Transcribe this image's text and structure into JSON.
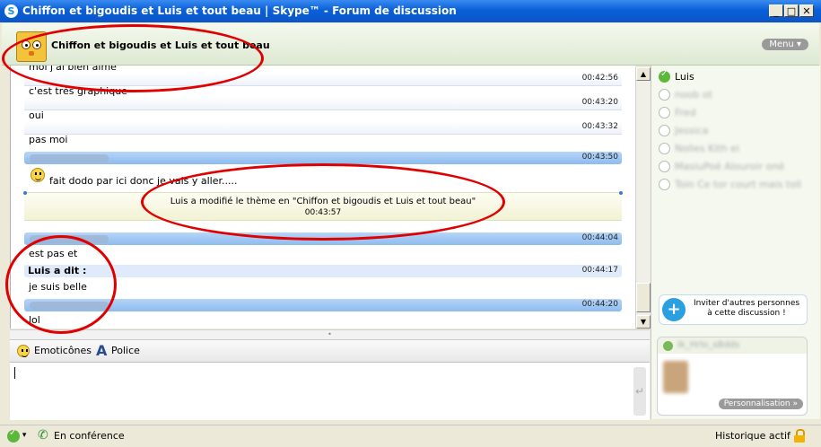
{
  "window": {
    "title": "Chiffon et bigoudis et Luis et tout beau | Skype™ - Forum de discussion",
    "min": "_",
    "max": "□",
    "close": "✕"
  },
  "header": {
    "title": "Chiffon et bigoudis et Luis et tout beau",
    "menu_label": "Menu"
  },
  "chat": {
    "rows": [
      {
        "kind": "msg",
        "text": "moi j'ai bien aimé"
      },
      {
        "kind": "sep",
        "time": "00:42:56"
      },
      {
        "kind": "msg",
        "text": "c'est très graphique"
      },
      {
        "kind": "sep",
        "time": "00:43:20"
      },
      {
        "kind": "msg",
        "text": "oui"
      },
      {
        "kind": "sep",
        "time": "00:43:32"
      },
      {
        "kind": "msg",
        "text": "pas moi"
      },
      {
        "kind": "bar",
        "time": "00:43:50"
      },
      {
        "kind": "msg",
        "text": "fait dodo par ici donc je vais y aller....."
      },
      {
        "kind": "bar",
        "time": "00:44:04"
      },
      {
        "kind": "msg",
        "text": "est pas et"
      },
      {
        "kind": "luis",
        "name": "Luis a dit :",
        "time": "00:44:17"
      },
      {
        "kind": "msg",
        "text": "je suis belle"
      },
      {
        "kind": "bar",
        "time": "00:44:20"
      },
      {
        "kind": "msg",
        "text": "lol"
      }
    ],
    "notice": {
      "text": "Luis a modifié le thème en \"Chiffon et bigoudis et Luis et tout beau\"",
      "time": "00:43:57"
    }
  },
  "toolbar": {
    "emoticons_label": "Emoticônes",
    "font_label": "Police"
  },
  "participants": [
    {
      "name": "Luis",
      "online": true
    },
    {
      "name": "noob ot",
      "online": false
    },
    {
      "name": "Fred",
      "online": false
    },
    {
      "name": "Jessica",
      "online": false
    },
    {
      "name": "Nolles Kith ei",
      "online": false
    },
    {
      "name": "MasiuPoé  Alouroir oné",
      "online": false
    },
    {
      "name": "Toin  Ce tor court mais toll",
      "online": false
    }
  ],
  "invite": {
    "label": "Inviter d'autres personnes à cette discussion !"
  },
  "profile_card": {
    "name": "Ik_Hrlo_sBdds",
    "button": "Personnalisation"
  },
  "status": {
    "conference_label": "En conférence",
    "history_label": "Historique actif"
  },
  "colors": {
    "title_bar": "#0a5fd8",
    "header_bg": "#dde9d2",
    "timestamp_bar": "#8dbbef",
    "annotation_red": "#e00000",
    "online_green": "#5cb83a"
  }
}
